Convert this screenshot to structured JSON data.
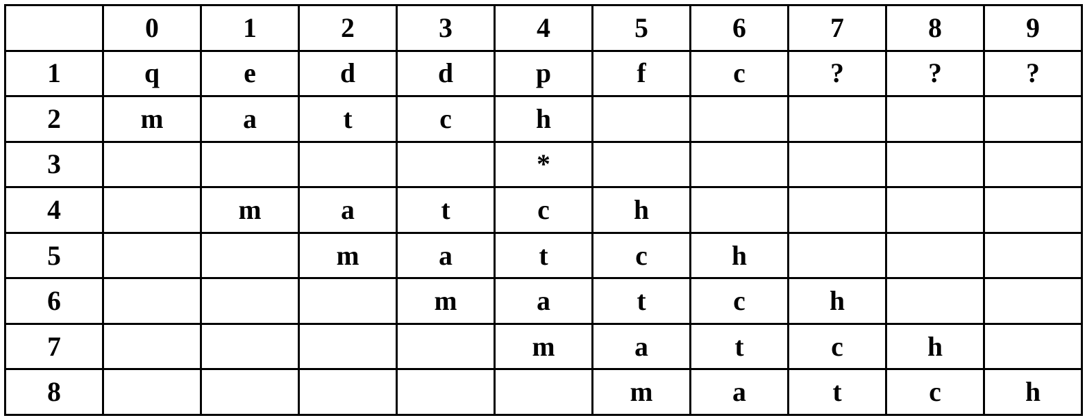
{
  "chart_data": {
    "type": "table",
    "title": "",
    "columns": 11,
    "rows": [
      [
        "",
        "0",
        "1",
        "2",
        "3",
        "4",
        "5",
        "6",
        "7",
        "8",
        "9"
      ],
      [
        "1",
        "q",
        "e",
        "d",
        "d",
        "p",
        "f",
        "c",
        "?",
        "?",
        "?"
      ],
      [
        "2",
        "m",
        "a",
        "t",
        "c",
        "h",
        "",
        "",
        "",
        "",
        ""
      ],
      [
        "3",
        "",
        "",
        "",
        "",
        "*",
        "",
        "",
        "",
        "",
        ""
      ],
      [
        "4",
        "",
        "m",
        "a",
        "t",
        "c",
        "h",
        "",
        "",
        "",
        ""
      ],
      [
        "5",
        "",
        "",
        "m",
        "a",
        "t",
        "c",
        "h",
        "",
        "",
        ""
      ],
      [
        "6",
        "",
        "",
        "",
        "m",
        "a",
        "t",
        "c",
        "h",
        "",
        ""
      ],
      [
        "7",
        "",
        "",
        "",
        "",
        "m",
        "a",
        "t",
        "c",
        "h",
        ""
      ],
      [
        "8",
        "",
        "",
        "",
        "",
        "",
        "m",
        "a",
        "t",
        "c",
        "h"
      ]
    ]
  }
}
